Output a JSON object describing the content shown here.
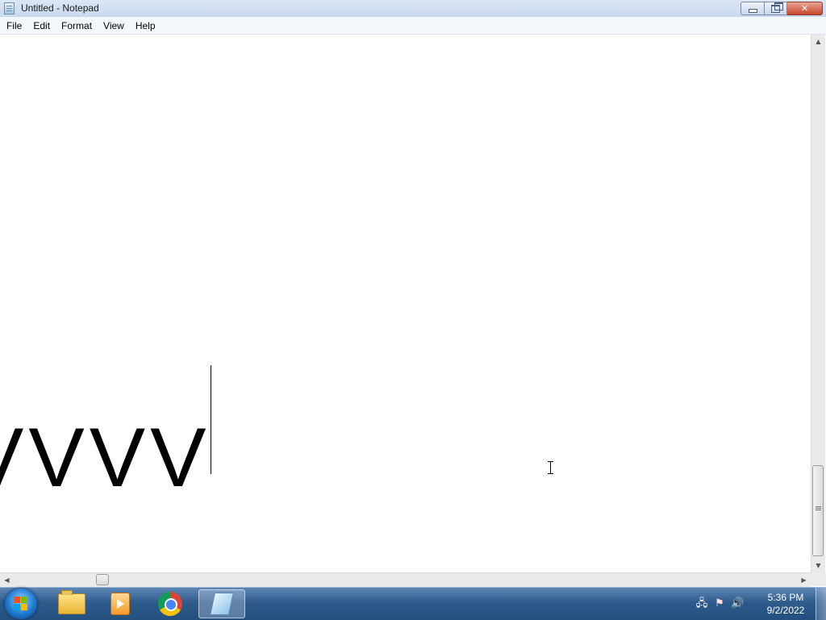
{
  "window": {
    "title": "Untitled - Notepad",
    "buttons": {
      "minimize": "minimize",
      "maximize": "restore",
      "close": "✕"
    }
  },
  "menu": {
    "items": [
      "File",
      "Edit",
      "Format",
      "View",
      "Help"
    ]
  },
  "editor": {
    "content": "VVVV"
  },
  "taskbar": {
    "pinned": [
      "start-orb",
      "windows-explorer",
      "media-player",
      "google-chrome",
      "notepad"
    ],
    "active": "notepad"
  },
  "tray": {
    "icons": [
      "network-icon",
      "action-center-icon",
      "volume-icon"
    ],
    "time": "5:36 PM",
    "date": "9/2/2022"
  }
}
